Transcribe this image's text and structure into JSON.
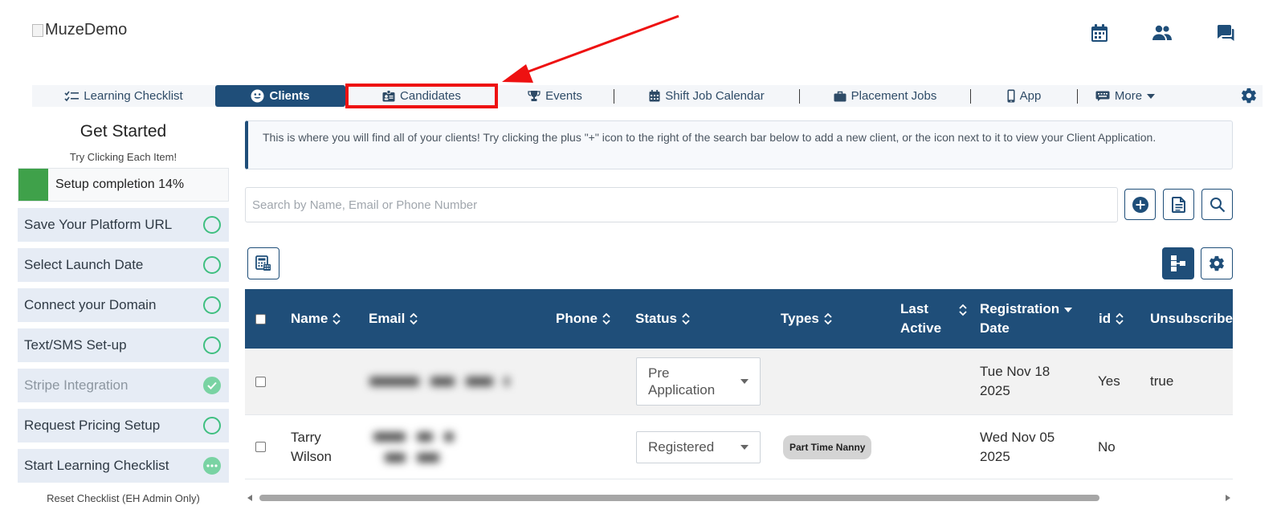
{
  "header": {
    "logo_alt": "MuzeDemo",
    "icons": [
      "calendar-icon",
      "people-icon",
      "chat-icon"
    ]
  },
  "nav": {
    "items": [
      {
        "label": "Learning Checklist",
        "icon": "checklist-icon"
      },
      {
        "label": "Clients",
        "icon": "smile-icon",
        "active": true
      },
      {
        "label": "Candidates",
        "icon": "badge-icon",
        "highlighted": true
      },
      {
        "label": "Events",
        "icon": "trophy-icon"
      },
      {
        "label": "Shift Job Calendar",
        "icon": "calendar-icon"
      },
      {
        "label": "Placement Jobs",
        "icon": "briefcase-icon"
      },
      {
        "label": "App",
        "icon": "mobile-icon"
      },
      {
        "label": "More",
        "icon": "keyboard-icon"
      }
    ],
    "settings_icon": "gear-icon"
  },
  "checklist": {
    "title": "Get Started",
    "subtitle": "Try Clicking Each Item!",
    "progress_label": "Setup completion 14%",
    "progress_percent": 14,
    "steps": [
      {
        "label": "Save Your Platform URL",
        "state": "todo"
      },
      {
        "label": "Select Launch Date",
        "state": "todo"
      },
      {
        "label": "Connect your Domain",
        "state": "todo"
      },
      {
        "label": "Text/SMS Set-up",
        "state": "todo"
      },
      {
        "label": "Stripe Integration",
        "state": "done"
      },
      {
        "label": "Request Pricing Setup",
        "state": "todo"
      },
      {
        "label": "Start Learning Checklist",
        "state": "in-progress"
      }
    ],
    "reset_label": "Reset Checklist (EH Admin Only)"
  },
  "info": {
    "text": "This is where you will find all of your clients! Try clicking the plus \"+\" icon to the right of the search bar below to add a new client, or the icon next to it to view your Client Application."
  },
  "search": {
    "placeholder": "Search by Name, Email or Phone Number",
    "value": ""
  },
  "colors": {
    "primary": "#1f4e79",
    "accent_green": "#3fa14a",
    "highlight_red": "#ee1111"
  },
  "table": {
    "columns": [
      "Name",
      "Email",
      "Phone",
      "Status",
      "Types",
      "Last Active",
      "Registration Date",
      "id",
      "Unsubscribed"
    ],
    "col_last_1": "Last",
    "col_last_2": "Active",
    "col_reg_1": "Registration",
    "col_reg_2": "Date",
    "rows": [
      {
        "name": "",
        "status_1": "Pre",
        "status_2": "Application",
        "type": "",
        "reg_1": "Tue Nov 18",
        "reg_2": "2025",
        "id": "Yes",
        "unsubscribed": "true"
      },
      {
        "name_1": "Tarry",
        "name_2": "Wilson",
        "status": "Registered",
        "type": "Part Time Nanny",
        "reg_1": "Wed Nov 05",
        "reg_2": "2025",
        "id": "No",
        "unsubscribed": ""
      }
    ]
  }
}
